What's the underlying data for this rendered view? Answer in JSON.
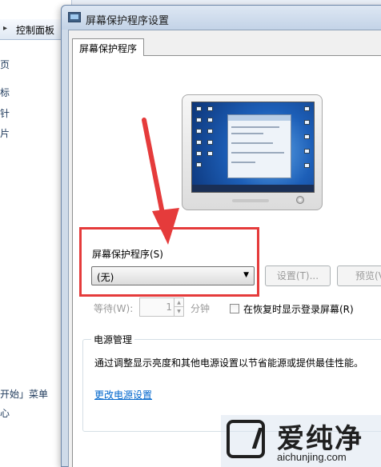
{
  "background_window": {
    "address_arrow": "▸",
    "breadcrumb": "控制面板",
    "side_items": [
      "页",
      "标",
      "针",
      "片",
      "开始」菜单",
      "心"
    ]
  },
  "dialog": {
    "title": "屏幕保护程序设置",
    "tab_label": "屏幕保护程序"
  },
  "screensaver": {
    "group_label": "屏幕保护程序(S)",
    "selected_value": "(无)",
    "settings_label": "设置(T)...",
    "preview_label": "预览(V)",
    "wait_label": "等待(W):",
    "wait_value": "1",
    "wait_unit": "分钟",
    "logon_label": "在恢复时显示登录屏幕(R)",
    "logon_checked": false
  },
  "power": {
    "group_label": "电源管理",
    "description": "通过调整显示亮度和其他电源设置以节省能源或提供最佳性能。",
    "link_label": "更改电源设置"
  },
  "watermark": {
    "title": "爱纯净",
    "url": "aichunjing.com"
  },
  "colors": {
    "annotation_red": "#e53b3b",
    "link_blue": "#0066cc"
  }
}
